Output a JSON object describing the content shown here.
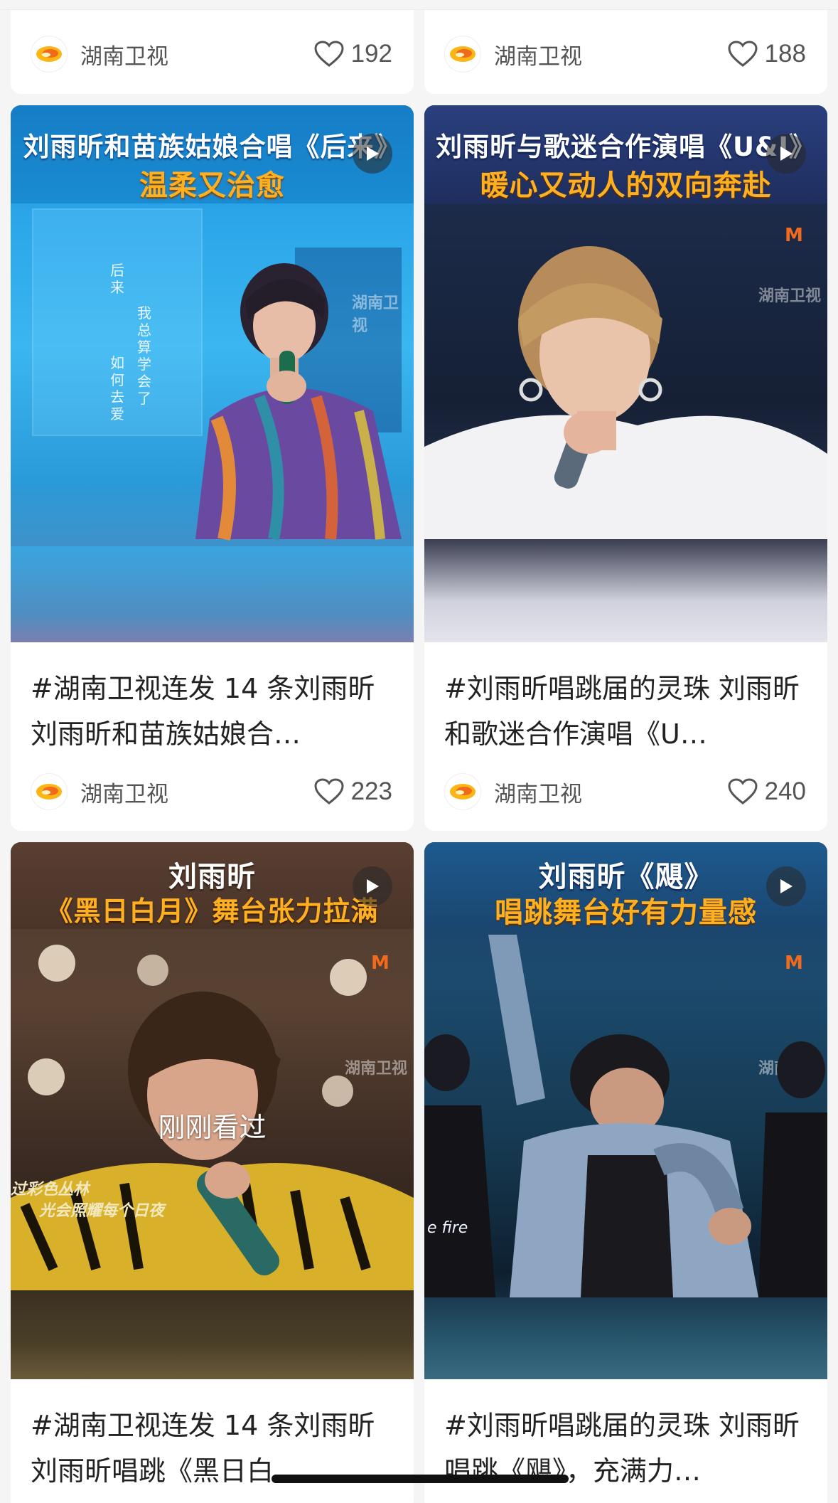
{
  "cards": [
    {
      "author": "湖南卫视",
      "likes": "192"
    },
    {
      "author": "湖南卫视",
      "likes": "188"
    },
    {
      "thumb_title_line1": "刘雨昕和苗族姑娘合唱《后来》",
      "thumb_title_line2": "温柔又治愈",
      "text": "#湖南卫视连发 14 条刘雨昕 刘雨昕和苗族姑娘合…",
      "author": "湖南卫视",
      "likes": "223",
      "lyric_lines": [
        "后来",
        "我总算学会了",
        "如何　去爱"
      ],
      "watermark": "湖南卫视"
    },
    {
      "thumb_title_line1": "刘雨昕与歌迷合作演唱《U&I》",
      "thumb_title_line2": "暖心又动人的双向奔赴",
      "text": "#刘雨昕唱跳届的灵珠 刘雨昕和歌迷合作演唱《U…",
      "author": "湖南卫视",
      "likes": "240",
      "watermark": "湖南卫视"
    },
    {
      "thumb_title_line1": "刘雨昕",
      "thumb_title_line2": "《黑日白月》舞台张力拉满",
      "overlay_label": "刚刚看过",
      "side_caption_1": "过彩色丛林",
      "side_caption_2": "光会照耀每个日夜",
      "text": "#湖南卫视连发 14 条刘雨昕 刘雨昕唱跳《黑日白…",
      "watermark": "湖南卫视"
    },
    {
      "thumb_title_line1": "刘雨昕《飓》",
      "thumb_title_line2": "唱跳舞台好有力量感",
      "side_caption_1": "e fire",
      "text": "#刘雨昕唱跳届的灵珠 刘雨昕唱跳《飓》，充满力…",
      "watermark": "湖南卫视"
    }
  ],
  "colors": {
    "title_white": "#ffffff",
    "title_orange": "#ffb020",
    "bg": "#f5f5f5",
    "card": "#ffffff"
  }
}
